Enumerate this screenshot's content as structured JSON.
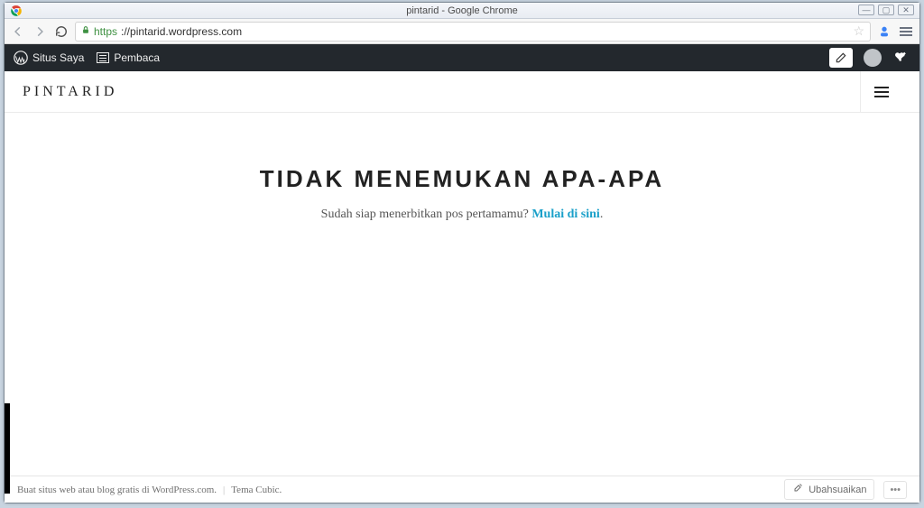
{
  "window": {
    "title": "pintarid - Google Chrome"
  },
  "browser": {
    "url_protocol": "https",
    "url_rest": "://pintarid.wordpress.com"
  },
  "wp_bar": {
    "my_sites": "Situs Saya",
    "reader": "Pembaca"
  },
  "site": {
    "title": "PINTARID",
    "headline": "TIDAK MENEMUKAN APA-APA",
    "subtext_prefix": "Sudah siap menerbitkan pos pertamamu? ",
    "subtext_link": "Mulai di sini",
    "subtext_suffix": "."
  },
  "footer": {
    "line1": "Buat situs web atau blog gratis di WordPress.com.",
    "theme": "Tema Cubic.",
    "customize": "Ubahsuaikan"
  }
}
